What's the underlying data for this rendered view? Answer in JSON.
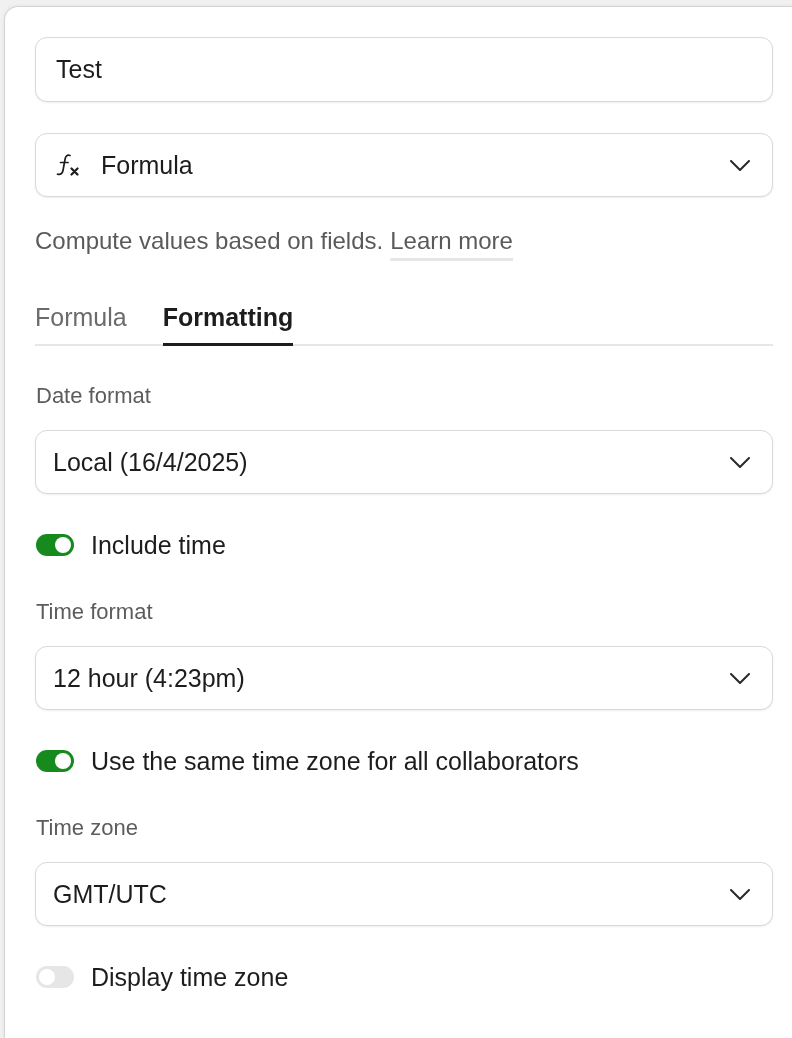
{
  "name_field": {
    "value": "Test"
  },
  "type_select": {
    "value": "Formula"
  },
  "description": {
    "text": "Compute values based on fields.",
    "link": "Learn more"
  },
  "tabs": [
    {
      "label": "Formula",
      "selected": false
    },
    {
      "label": "Formatting",
      "selected": true
    }
  ],
  "settings": [
    {
      "kind": "select",
      "label": "Date format",
      "value": "Local (16/4/2025)"
    },
    {
      "kind": "toggle",
      "label": "Include time",
      "on": true
    },
    {
      "kind": "select",
      "label": "Time format",
      "value": "12 hour (4:23pm)"
    },
    {
      "kind": "toggle",
      "label": "Use the same time zone for all collaborators",
      "on": true
    },
    {
      "kind": "select",
      "label": "Time zone",
      "value": "GMT/UTC"
    },
    {
      "kind": "toggle",
      "label": "Display time zone",
      "on": false
    }
  ]
}
